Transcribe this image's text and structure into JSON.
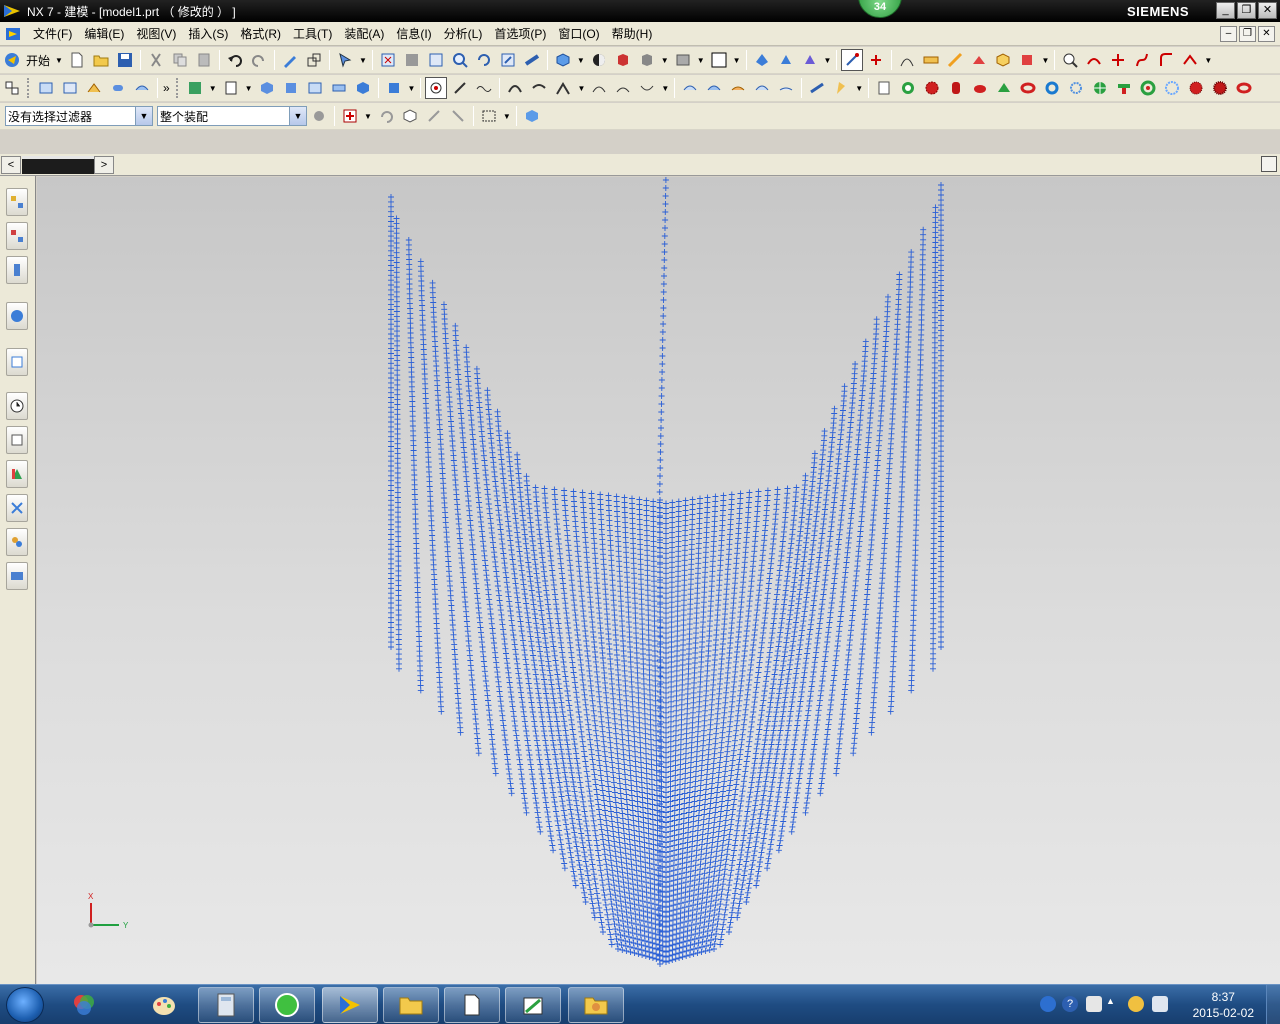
{
  "titlebar": {
    "title": "NX 7 - 建模 - [model1.prt （ 修改的 ） ]",
    "badge": "34",
    "brand": "SIEMENS",
    "minimize": "_",
    "restore": "❐",
    "close": "✕"
  },
  "menubar": {
    "items": [
      "文件(F)",
      "编辑(E)",
      "视图(V)",
      "插入(S)",
      "格式(R)",
      "工具(T)",
      "装配(A)",
      "信息(I)",
      "分析(L)",
      "首选项(P)",
      "窗口(O)",
      "帮助(H)"
    ],
    "mdi_minimize": "–",
    "mdi_restore": "❐",
    "mdi_close": "✕"
  },
  "toolbar1": {
    "start_label": "开始",
    "more": "»"
  },
  "toolbar3": {
    "selection_filter": "没有选择过滤器",
    "assembly_scope": "整个装配"
  },
  "tabstrip": {
    "left_arrow": "<",
    "right_arrow": ">"
  },
  "viewport": {
    "triad_x": "X",
    "triad_y": "Y",
    "point_color": "#2a5fd6"
  },
  "taskbar": {
    "time": "8:37",
    "date": "2015-02-02",
    "tray_up": "▲"
  },
  "colors": {
    "titlebar": "#000000",
    "menubar": "#ece9d8",
    "taskbar": "#1f4c82",
    "accent_green": "#2a9a3c"
  }
}
